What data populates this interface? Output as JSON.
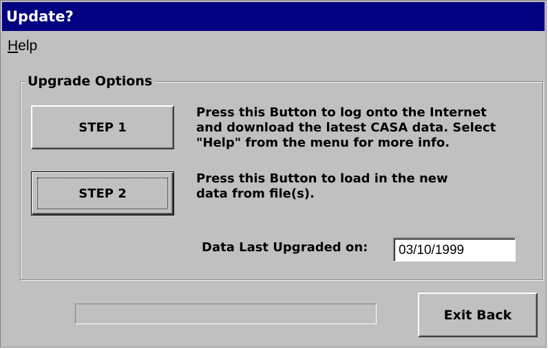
{
  "window": {
    "title": "Update?"
  },
  "menu": {
    "help_accel": "H",
    "help_rest": "elp"
  },
  "group": {
    "title": "Upgrade Options"
  },
  "step1": {
    "label": "STEP 1",
    "description_lines": [
      "Press this Button to log onto the Internet",
      "and download the latest CASA data. Select",
      "\"Help\" from the menu for more info."
    ]
  },
  "step2": {
    "label": "STEP 2",
    "description_lines": [
      "Press this Button to load in the new",
      "data from file(s)."
    ]
  },
  "last_upgrade": {
    "label": "Data Last Upgraded on:",
    "value": "03/10/1999"
  },
  "progress": {
    "value": 0
  },
  "exit": {
    "label": "Exit Back"
  },
  "colors": {
    "titlebar": "#000080",
    "face": "#c0c0c0"
  },
  "icons": {
    "title": "none"
  }
}
